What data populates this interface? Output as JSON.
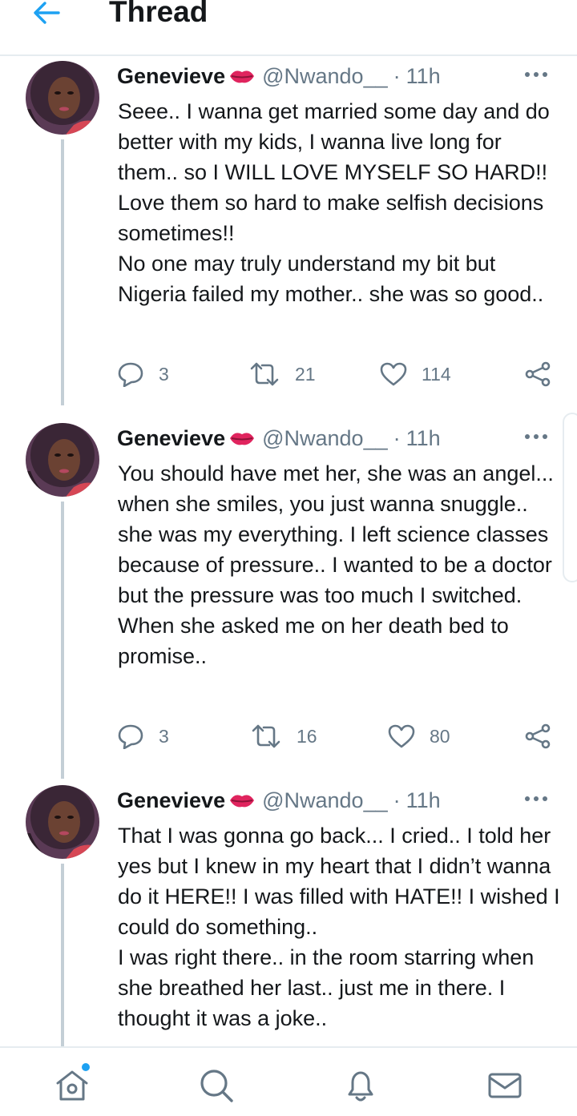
{
  "header": {
    "title": "Thread",
    "back_icon": "arrow-left-icon",
    "accent_color": "#1da1f2"
  },
  "tweets": [
    {
      "name": "Genevieve",
      "handle": "@Nwando__",
      "time": "11h",
      "separator": "·",
      "text": "Seee.. I wanna get married some day and do better with my kids, I wanna live long for them.. so I WILL LOVE MYSELF SO HARD!! Love them so hard to make selfish decisions sometimes!!\nNo one may truly understand my bit but Nigeria failed my mother.. she was so good..",
      "replies": "3",
      "retweets": "21",
      "likes": "114"
    },
    {
      "name": "Genevieve",
      "handle": "@Nwando__",
      "time": "11h",
      "separator": "·",
      "text": "You should have met her, she was an angel... when she smiles, you just wanna snuggle.. she was my everything. I left science classes because of pressure.. I wanted to be a doctor but the pressure was too much I switched.\nWhen she asked me on her death bed to promise..",
      "replies": "3",
      "retweets": "16",
      "likes": "80"
    },
    {
      "name": "Genevieve",
      "handle": "@Nwando__",
      "time": "11h",
      "separator": "·",
      "text": "That I was gonna go back... I cried.. I told her yes but I knew in my heart that I didn’t wanna do it HERE!! I was filled with HATE!! I wished I could do something..\nI was right there.. in the room starring when she breathed her last.. just me in there. I thought it was a joke.."
    }
  ],
  "bottom_nav": {
    "items": [
      "home-icon",
      "search-icon",
      "notifications-icon",
      "messages-icon"
    ],
    "icon_color": "#657786"
  }
}
